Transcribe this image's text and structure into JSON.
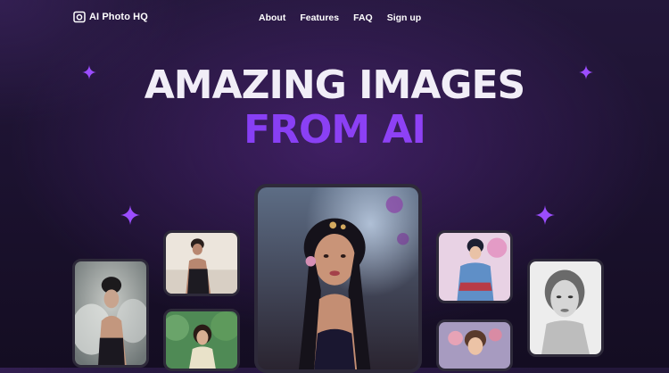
{
  "brand": {
    "name": "AI Photo HQ",
    "icon": "camera-icon"
  },
  "nav": {
    "items": [
      "About",
      "Features",
      "FAQ",
      "Sign up"
    ]
  },
  "hero": {
    "line1": "AMAZING IMAGES",
    "line2": "FROM AI"
  },
  "colors": {
    "accent": "#8a3cf5",
    "sparkle": "#9b4dff",
    "background": "#1c1230"
  },
  "gallery": [
    "portrait-smoke-woman",
    "portrait-yoga-woman",
    "portrait-forest-woman",
    "portrait-floral-woman-center",
    "portrait-comic-warrior",
    "portrait-floral-woman",
    "portrait-pencil-sketch"
  ]
}
